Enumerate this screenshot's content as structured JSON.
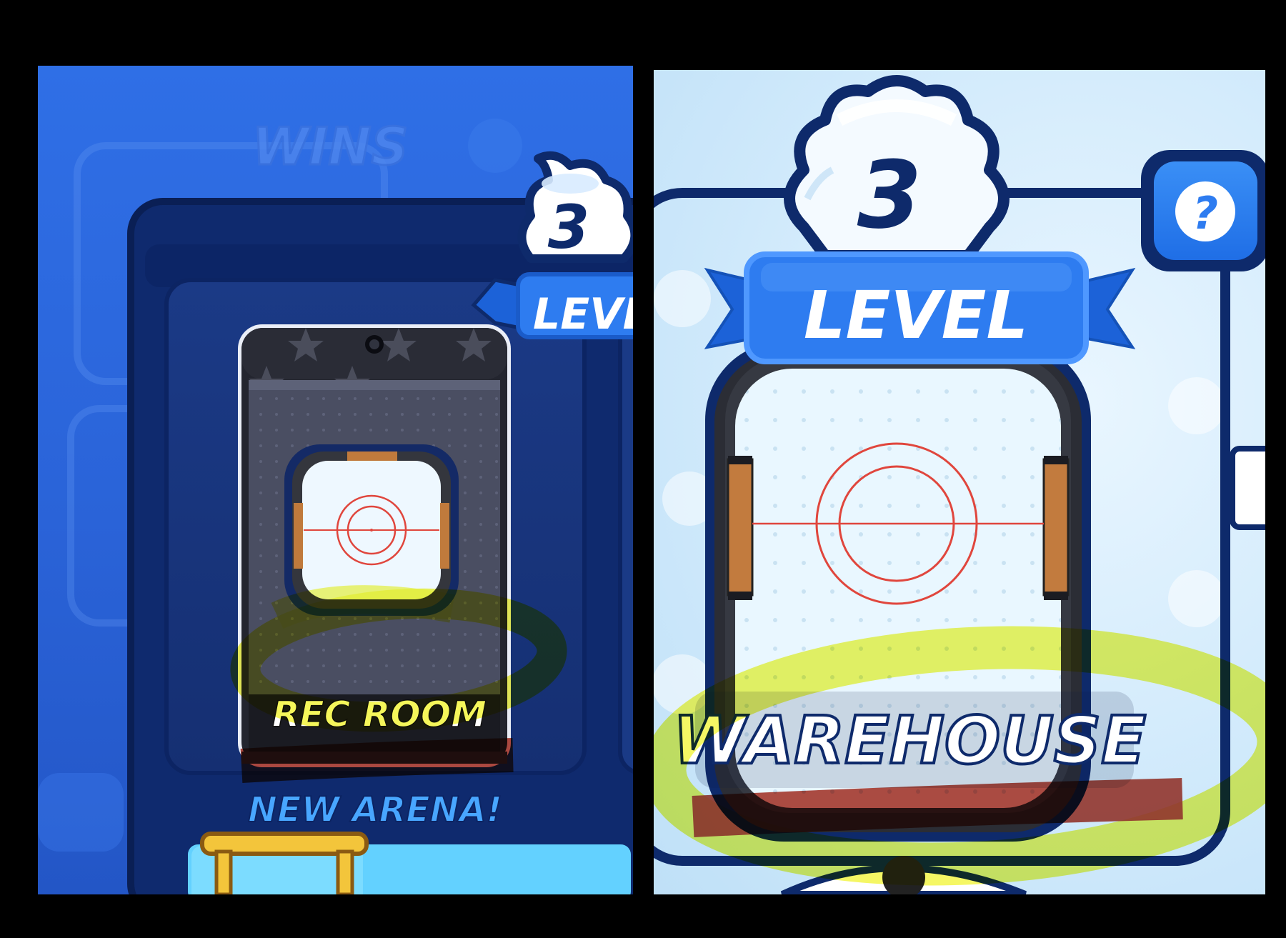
{
  "left_screen": {
    "wins_label": "WINS",
    "level_number": "3",
    "level_label": "LEVEL",
    "arena_name": "REC ROOM",
    "new_arena_label": "NEW ARENA!"
  },
  "right_screen": {
    "level_number": "3",
    "level_label": "LEVEL",
    "arena_name": "WAREHOUSE",
    "help_symbol": "?"
  },
  "annotations": {
    "highlight_color": "#f3f53d",
    "underline_color": "#b23a2e"
  },
  "colors": {
    "screen_blue": "#2f6fe6",
    "navy_frame": "#0e2a6b",
    "ribbon_blue": "#2e7cf0",
    "badge_white": "#ffffff",
    "rink_line_red": "#e0463d"
  },
  "icons": [
    "help-icon",
    "level-badge-icon",
    "ribbon-icon",
    "rink-icon",
    "star-icon"
  ]
}
